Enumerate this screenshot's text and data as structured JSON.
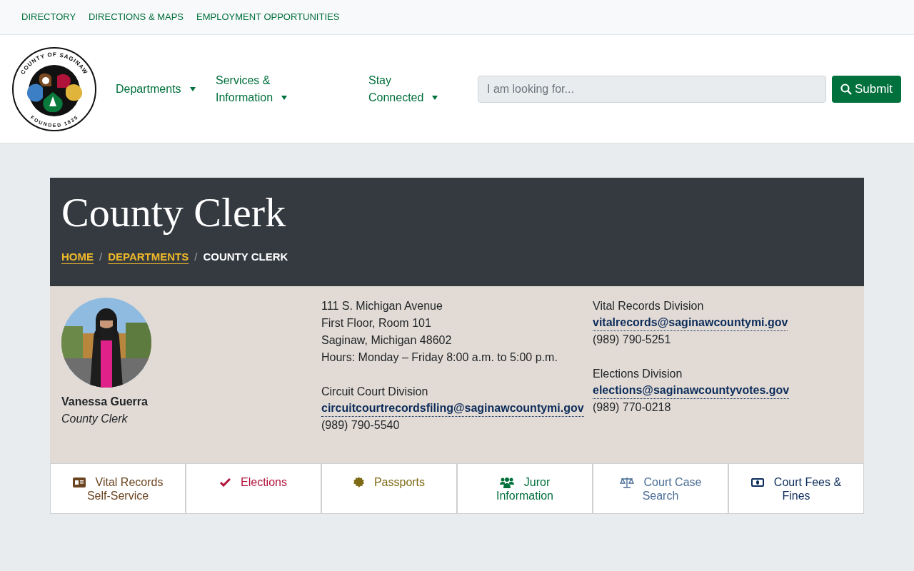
{
  "top_links": [
    "DIRECTORY",
    "DIRECTIONS & MAPS",
    "EMPLOYMENT OPPORTUNITIES"
  ],
  "logo": {
    "top_text": "COUNTY OF SAGINAW",
    "bottom_text": "FOUNDED 1835"
  },
  "nav": [
    {
      "lines": [
        "Departments"
      ]
    },
    {
      "lines": [
        "Services &",
        "Information"
      ]
    },
    {
      "lines": [
        "Stay",
        "Connected"
      ]
    }
  ],
  "search": {
    "placeholder": "I am looking for...",
    "button": "Submit"
  },
  "page": {
    "title": "County Clerk",
    "breadcrumbs": [
      {
        "label": "HOME",
        "link": true
      },
      {
        "label": "DEPARTMENTS",
        "link": true
      },
      {
        "label": "COUNTY CLERK",
        "link": false
      }
    ],
    "separator": "/"
  },
  "official": {
    "name": "Vanessa Guerra",
    "role": "County Clerk"
  },
  "address": {
    "lines": [
      "111 S. Michigan Avenue",
      "First Floor, Room 101",
      "Saginaw, Michigan 48602",
      "Hours: Monday – Friday 8:00 a.m. to 5:00 p.m."
    ]
  },
  "court_division": {
    "name": "Circuit Court Division",
    "email": "circuitcourtrecordsfiling@saginawcountymi.gov",
    "phone": "(989) 790-5540"
  },
  "divisions": [
    {
      "name": "Vital Records Division",
      "email": "vitalrecords@saginawcountymi.gov",
      "phone": "(989) 790-5251"
    },
    {
      "name": "Elections Division",
      "email": "elections@saginawcountyvotes.gov",
      "phone": "(989) 770-0218"
    }
  ],
  "quick_links": [
    {
      "kind": "id-card",
      "lines": [
        "Vital Records",
        "Self-Service"
      ],
      "color": "#6b4420"
    },
    {
      "kind": "check",
      "lines": [
        "Elections"
      ],
      "color": "#b0133a"
    },
    {
      "kind": "seal",
      "lines": [
        "Passports"
      ],
      "color": "#7d6a14"
    },
    {
      "kind": "people",
      "lines": [
        "Juror",
        "Information"
      ],
      "color": "#00703c"
    },
    {
      "kind": "scales",
      "lines": [
        "Court Case",
        "Search"
      ],
      "color": "#4a6d96"
    },
    {
      "kind": "money",
      "lines": [
        "Court Fees &",
        "Fines"
      ],
      "color": "#0b2b5a"
    }
  ]
}
